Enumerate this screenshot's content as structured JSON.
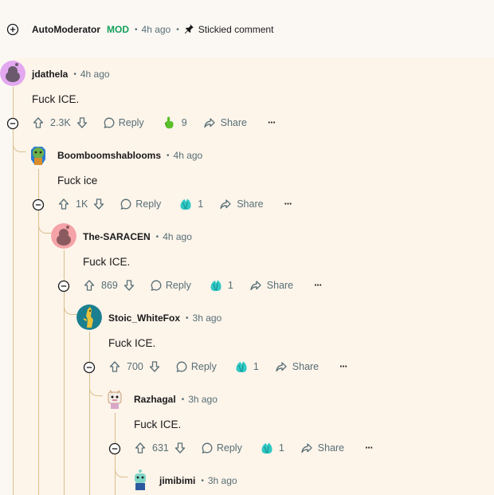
{
  "sticky": {
    "username": "AutoModerator",
    "badge": "MOD",
    "time": "4h ago",
    "status": "Stickied comment"
  },
  "comments": [
    {
      "username": "jdathela",
      "time": "4h ago",
      "text": "Fuck ICE.",
      "score": "2.3K",
      "reply": "Reply",
      "award_icon": "pointing-hand-award-icon",
      "award_count": "9",
      "share": "Share",
      "more": "···"
    },
    {
      "username": "Boomboomshablooms",
      "time": "4h ago",
      "text": "Fuck ice",
      "score": "1K",
      "reply": "Reply",
      "award_icon": "crystal-award-icon",
      "award_count": "1",
      "share": "Share",
      "more": "···"
    },
    {
      "username": "The-SARACEN",
      "time": "4h ago",
      "text": "Fuck ICE.",
      "score": "869",
      "reply": "Reply",
      "award_icon": "crystal-award-icon",
      "award_count": "1",
      "share": "Share",
      "more": "···"
    },
    {
      "username": "Stoic_WhiteFox",
      "time": "3h ago",
      "text": "Fuck ICE.",
      "score": "700",
      "reply": "Reply",
      "award_icon": "crystal-award-icon",
      "award_count": "1",
      "share": "Share",
      "more": "···"
    },
    {
      "username": "Razhagal",
      "time": "3h ago",
      "text": "Fuck ICE.",
      "score": "631",
      "reply": "Reply",
      "award_icon": "crystal-award-icon",
      "award_count": "1",
      "share": "Share",
      "more": "···"
    },
    {
      "username": "jimibimi",
      "time": "3h ago"
    }
  ],
  "colors": {
    "mod_green": "#14a05a",
    "thread_line": "#d9c08c",
    "highlight_bg": "#fdf4ea",
    "meta_gray": "#576f76",
    "award_teal": "#30c9c5",
    "award_green": "#5bbf2a"
  }
}
